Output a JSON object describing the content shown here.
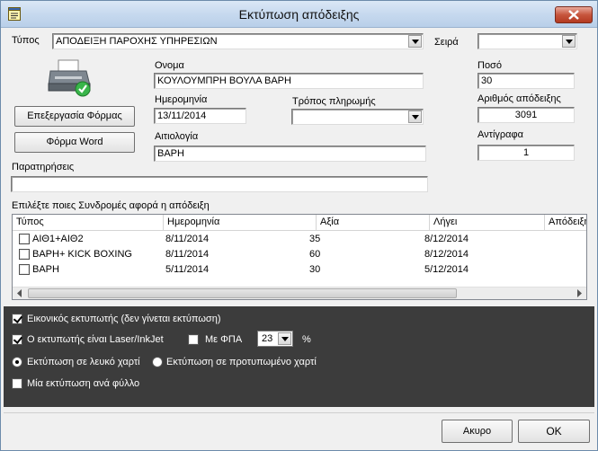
{
  "window": {
    "title": "Εκτύπωση απόδειξης"
  },
  "form": {
    "type_label": "Τύπος",
    "type_value": "ΑΠΟΔΕΙΞΗ ΠΑΡΟΧΗΣ ΥΠΗΡΕΣΙΩΝ",
    "series_label": "Σειρά",
    "series_value": "",
    "name_label": "Ονομα",
    "name_value": "ΚΟΥΛΟΥΜΠΡΗ ΒΟΥΛΑ ΒΑΡΗ",
    "amount_label": "Ποσό",
    "amount_value": "30",
    "date_label": "Ημερομηνία",
    "date_value": "13/11/2014",
    "payment_label": "Τρόπος πληρωμής",
    "payment_value": "",
    "receipt_no_label": "Αριθμός απόδειξης",
    "receipt_no_value": "3091",
    "reason_label": "Αιτιολογία",
    "reason_value": "ΒΑΡΗ",
    "copies_label": "Αντίγραφα",
    "copies_value": "1",
    "notes_label": "Παρατηρήσεις",
    "notes_value": "",
    "edit_form_button": "Επεξεργασία Φόρμας",
    "word_form_button": "Φόρμα Word"
  },
  "subscriptions": {
    "caption": "Επιλέξτε ποιες Συνδρομές αφορά η απόδειξη",
    "columns": [
      "Τύπος",
      "Ημερομηνία",
      "Αξία",
      "Λήγει",
      "Απόδειξη"
    ],
    "rows": [
      {
        "checked": false,
        "type": "ΑΙΘ1+ΑΙΘ2",
        "date": "8/11/2014",
        "value": "35",
        "expires": "8/12/2014",
        "receipt": ""
      },
      {
        "checked": false,
        "type": "ΒΑΡΗ+ KICK BOXING",
        "date": "8/11/2014",
        "value": "60",
        "expires": "8/12/2014",
        "receipt": ""
      },
      {
        "checked": false,
        "type": "ΒΑΡΗ",
        "date": "5/11/2014",
        "value": "30",
        "expires": "5/12/2014",
        "receipt": ""
      }
    ]
  },
  "options": {
    "virtual_printer_label": "Εικονικός εκτυπωτής (δεν γίνεται εκτύπωση)",
    "virtual_printer_checked": true,
    "laser_label": "Ο εκτυπωτής είναι Laser/InkJet",
    "laser_checked": true,
    "vat_label": "Με ΦΠΑ",
    "vat_checked": false,
    "vat_rate": "23",
    "percent_sign": "%",
    "white_paper_label": "Εκτύπωση σε λευκό χαρτί",
    "white_paper_selected": true,
    "preprinted_label": "Εκτύπωση σε προτυπωμένο χαρτί",
    "preprinted_selected": false,
    "one_per_sheet_label": "Μία εκτύπωση ανά φύλλο",
    "one_per_sheet_checked": false
  },
  "footer": {
    "cancel_label": "Ακυρο",
    "ok_label": "OK"
  }
}
